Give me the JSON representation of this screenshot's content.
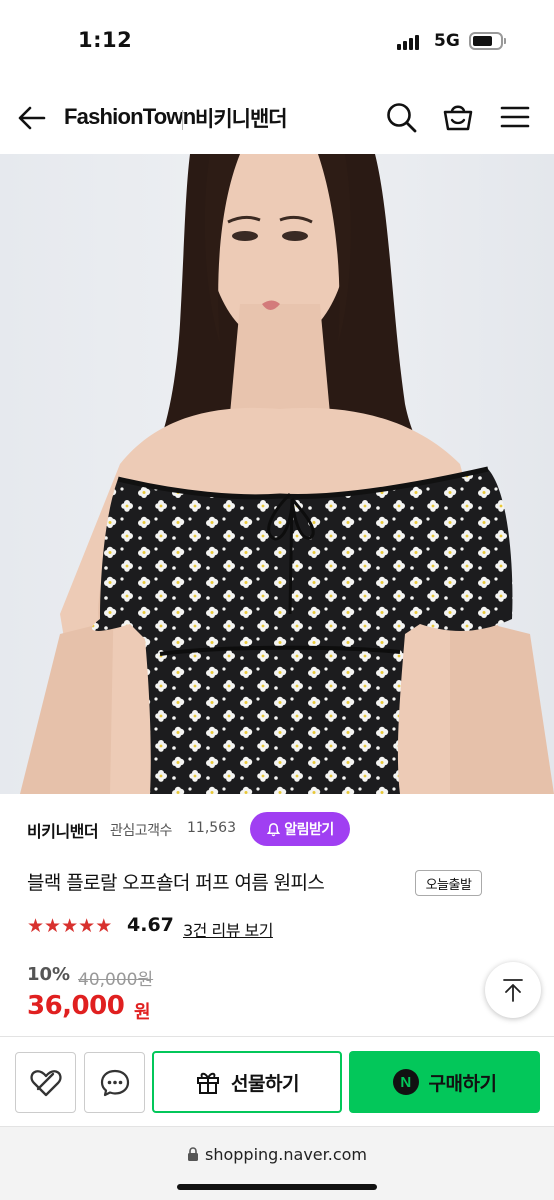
{
  "status_bar": {
    "time": "1:12",
    "network": "5G"
  },
  "header": {
    "brand": "FashionTown",
    "store_name": "비키니밴더"
  },
  "product": {
    "store_name": "비키니밴더",
    "watchers_label": "관심고객수",
    "watchers_count": "11,563",
    "alarm_button": "알림받기",
    "title": "블랙 플로랄 오프숄더 퍼프 여름 원피스",
    "delivery_tag": "오늘출발",
    "rating": "4.67",
    "rating_value": 4.67,
    "reviews_link": "3건 리뷰 보기",
    "discount": "10%",
    "original_price": "40,000원",
    "price": "36,000",
    "price_unit": "원"
  },
  "actions": {
    "gift_button": "선물하기",
    "buy_button": "구매하기",
    "npay_mark": "N"
  },
  "browser": {
    "url": "shopping.naver.com"
  },
  "colors": {
    "accent_purple": "#a03ff2",
    "naver_green": "#03c75a",
    "price_red": "#e02020",
    "star_red": "#d8312e"
  },
  "icons": [
    "back-arrow-icon",
    "search-icon",
    "basket-icon",
    "menu-icon",
    "bell-icon",
    "star-icon",
    "arrow-up-icon",
    "heart-icon",
    "chat-icon",
    "gift-icon",
    "lock-icon"
  ]
}
